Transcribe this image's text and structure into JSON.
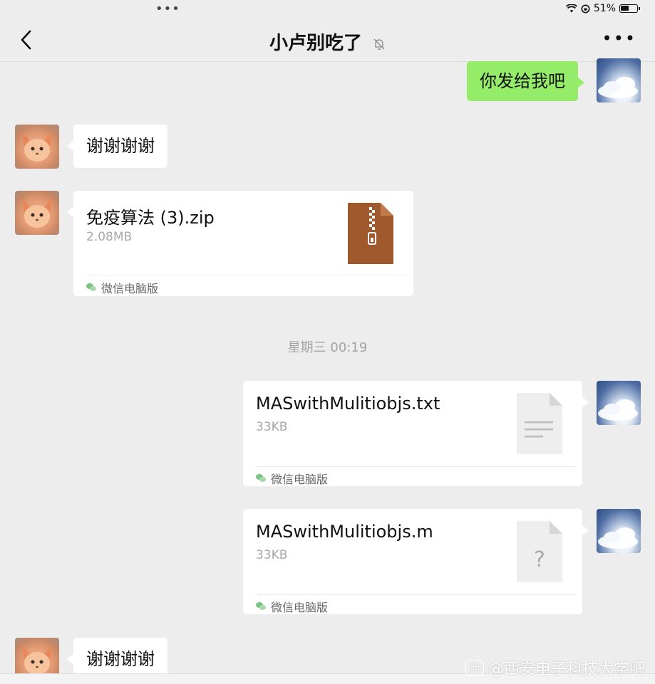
{
  "status_bar": {
    "battery": "51%",
    "wifi_icon": "wifi-icon",
    "lock_icon": "rotation-lock-icon"
  },
  "header": {
    "title": "小卢别吃了",
    "back_icon": "chevron-left-icon",
    "muted_icon": "bell-off-icon",
    "more_icon": "more-icon"
  },
  "messages": [
    {
      "side": "right",
      "type": "text",
      "text": "你发给我吧"
    },
    {
      "side": "left",
      "type": "text",
      "text": "谢谢谢谢"
    },
    {
      "side": "left",
      "type": "file",
      "name": "免疫算法 (3).zip",
      "size": "2.08MB",
      "source": "微信电脑版",
      "icon": "zip-file-icon",
      "icon_color": "#a0592c"
    },
    {
      "type": "timestamp",
      "text": "星期三 00:19"
    },
    {
      "side": "right",
      "type": "file",
      "name": "MASwithMulitiobjs.txt",
      "size": "33KB",
      "source": "微信电脑版",
      "icon": "text-file-icon"
    },
    {
      "side": "right",
      "type": "file",
      "name": "MASwithMulitiobjs.m",
      "size": "33KB",
      "source": "微信电脑版",
      "icon": "unknown-file-icon"
    },
    {
      "side": "left",
      "type": "text",
      "text": "谢谢谢谢"
    }
  ],
  "watermark": {
    "text": "@西安电子科技大学吧"
  },
  "colors": {
    "background": "#ededed",
    "bubble_self": "#95ec69",
    "bubble_other": "#ffffff"
  }
}
